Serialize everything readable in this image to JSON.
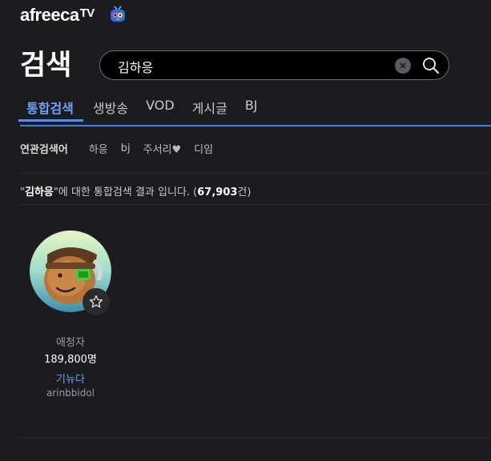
{
  "brand": {
    "logo_text": "afreeca",
    "logo_suffix": "TV"
  },
  "page": {
    "title": "검색"
  },
  "search": {
    "value": "김하응",
    "clear_icon": "close-icon",
    "submit_icon": "search-icon"
  },
  "tabs": [
    {
      "label": "통합검색",
      "active": true
    },
    {
      "label": "생방송",
      "active": false
    },
    {
      "label": "VOD",
      "active": false
    },
    {
      "label": "게시글",
      "active": false
    },
    {
      "label": "BJ",
      "active": false
    }
  ],
  "related": {
    "label": "연관검색어",
    "items": [
      "하응",
      "bj",
      "주서리♥",
      "디임"
    ]
  },
  "summary": {
    "open_quote": "\"",
    "keyword": "김하응",
    "middle": "\"에 대한 통합검색 결과 입니다. (",
    "count": "67,903",
    "tail": "건)"
  },
  "bj": {
    "viewers_label": "애청자",
    "viewers_count": "189,800명",
    "name": "기뉴다",
    "id": "arinbbidol",
    "favorite_icon": "star-outline-icon"
  },
  "colors": {
    "background": "#1c1c1f",
    "accent": "#4c8dff",
    "link": "#6aa1ff"
  }
}
